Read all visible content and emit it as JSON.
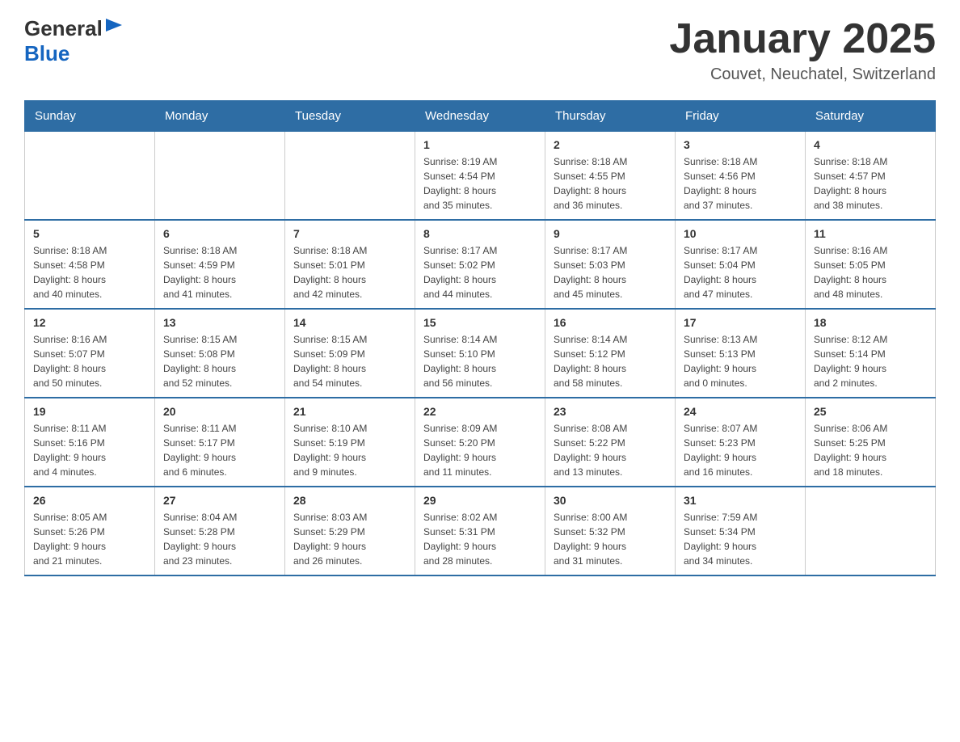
{
  "header": {
    "logo_general": "General",
    "logo_blue": "Blue",
    "title": "January 2025",
    "location": "Couvet, Neuchatel, Switzerland"
  },
  "calendar": {
    "days_of_week": [
      "Sunday",
      "Monday",
      "Tuesday",
      "Wednesday",
      "Thursday",
      "Friday",
      "Saturday"
    ],
    "weeks": [
      {
        "cells": [
          {
            "day": "",
            "info": ""
          },
          {
            "day": "",
            "info": ""
          },
          {
            "day": "",
            "info": ""
          },
          {
            "day": "1",
            "info": "Sunrise: 8:19 AM\nSunset: 4:54 PM\nDaylight: 8 hours\nand 35 minutes."
          },
          {
            "day": "2",
            "info": "Sunrise: 8:18 AM\nSunset: 4:55 PM\nDaylight: 8 hours\nand 36 minutes."
          },
          {
            "day": "3",
            "info": "Sunrise: 8:18 AM\nSunset: 4:56 PM\nDaylight: 8 hours\nand 37 minutes."
          },
          {
            "day": "4",
            "info": "Sunrise: 8:18 AM\nSunset: 4:57 PM\nDaylight: 8 hours\nand 38 minutes."
          }
        ]
      },
      {
        "cells": [
          {
            "day": "5",
            "info": "Sunrise: 8:18 AM\nSunset: 4:58 PM\nDaylight: 8 hours\nand 40 minutes."
          },
          {
            "day": "6",
            "info": "Sunrise: 8:18 AM\nSunset: 4:59 PM\nDaylight: 8 hours\nand 41 minutes."
          },
          {
            "day": "7",
            "info": "Sunrise: 8:18 AM\nSunset: 5:01 PM\nDaylight: 8 hours\nand 42 minutes."
          },
          {
            "day": "8",
            "info": "Sunrise: 8:17 AM\nSunset: 5:02 PM\nDaylight: 8 hours\nand 44 minutes."
          },
          {
            "day": "9",
            "info": "Sunrise: 8:17 AM\nSunset: 5:03 PM\nDaylight: 8 hours\nand 45 minutes."
          },
          {
            "day": "10",
            "info": "Sunrise: 8:17 AM\nSunset: 5:04 PM\nDaylight: 8 hours\nand 47 minutes."
          },
          {
            "day": "11",
            "info": "Sunrise: 8:16 AM\nSunset: 5:05 PM\nDaylight: 8 hours\nand 48 minutes."
          }
        ]
      },
      {
        "cells": [
          {
            "day": "12",
            "info": "Sunrise: 8:16 AM\nSunset: 5:07 PM\nDaylight: 8 hours\nand 50 minutes."
          },
          {
            "day": "13",
            "info": "Sunrise: 8:15 AM\nSunset: 5:08 PM\nDaylight: 8 hours\nand 52 minutes."
          },
          {
            "day": "14",
            "info": "Sunrise: 8:15 AM\nSunset: 5:09 PM\nDaylight: 8 hours\nand 54 minutes."
          },
          {
            "day": "15",
            "info": "Sunrise: 8:14 AM\nSunset: 5:10 PM\nDaylight: 8 hours\nand 56 minutes."
          },
          {
            "day": "16",
            "info": "Sunrise: 8:14 AM\nSunset: 5:12 PM\nDaylight: 8 hours\nand 58 minutes."
          },
          {
            "day": "17",
            "info": "Sunrise: 8:13 AM\nSunset: 5:13 PM\nDaylight: 9 hours\nand 0 minutes."
          },
          {
            "day": "18",
            "info": "Sunrise: 8:12 AM\nSunset: 5:14 PM\nDaylight: 9 hours\nand 2 minutes."
          }
        ]
      },
      {
        "cells": [
          {
            "day": "19",
            "info": "Sunrise: 8:11 AM\nSunset: 5:16 PM\nDaylight: 9 hours\nand 4 minutes."
          },
          {
            "day": "20",
            "info": "Sunrise: 8:11 AM\nSunset: 5:17 PM\nDaylight: 9 hours\nand 6 minutes."
          },
          {
            "day": "21",
            "info": "Sunrise: 8:10 AM\nSunset: 5:19 PM\nDaylight: 9 hours\nand 9 minutes."
          },
          {
            "day": "22",
            "info": "Sunrise: 8:09 AM\nSunset: 5:20 PM\nDaylight: 9 hours\nand 11 minutes."
          },
          {
            "day": "23",
            "info": "Sunrise: 8:08 AM\nSunset: 5:22 PM\nDaylight: 9 hours\nand 13 minutes."
          },
          {
            "day": "24",
            "info": "Sunrise: 8:07 AM\nSunset: 5:23 PM\nDaylight: 9 hours\nand 16 minutes."
          },
          {
            "day": "25",
            "info": "Sunrise: 8:06 AM\nSunset: 5:25 PM\nDaylight: 9 hours\nand 18 minutes."
          }
        ]
      },
      {
        "cells": [
          {
            "day": "26",
            "info": "Sunrise: 8:05 AM\nSunset: 5:26 PM\nDaylight: 9 hours\nand 21 minutes."
          },
          {
            "day": "27",
            "info": "Sunrise: 8:04 AM\nSunset: 5:28 PM\nDaylight: 9 hours\nand 23 minutes."
          },
          {
            "day": "28",
            "info": "Sunrise: 8:03 AM\nSunset: 5:29 PM\nDaylight: 9 hours\nand 26 minutes."
          },
          {
            "day": "29",
            "info": "Sunrise: 8:02 AM\nSunset: 5:31 PM\nDaylight: 9 hours\nand 28 minutes."
          },
          {
            "day": "30",
            "info": "Sunrise: 8:00 AM\nSunset: 5:32 PM\nDaylight: 9 hours\nand 31 minutes."
          },
          {
            "day": "31",
            "info": "Sunrise: 7:59 AM\nSunset: 5:34 PM\nDaylight: 9 hours\nand 34 minutes."
          },
          {
            "day": "",
            "info": ""
          }
        ]
      }
    ]
  }
}
